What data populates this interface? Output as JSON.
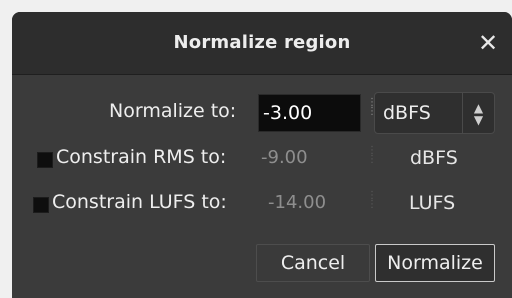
{
  "dialog": {
    "title": "Normalize region",
    "close_glyph": "✕"
  },
  "normalize_to": {
    "label": "Normalize to:",
    "value": "-3.00",
    "unit_select": {
      "selected": "dBFS",
      "chevron": "⌃⌄"
    }
  },
  "constrain_rms": {
    "label": "Constrain RMS to:",
    "value": "-9.00",
    "unit": "dBFS"
  },
  "constrain_lufs": {
    "label": "Constrain LUFS to:",
    "value": "-14.00",
    "unit": "LUFS"
  },
  "buttons": {
    "cancel": "Cancel",
    "normalize": "Normalize"
  },
  "icons": {
    "close": "close-icon",
    "spin": "spin-icon",
    "chevron": "chevron-updown-icon"
  }
}
